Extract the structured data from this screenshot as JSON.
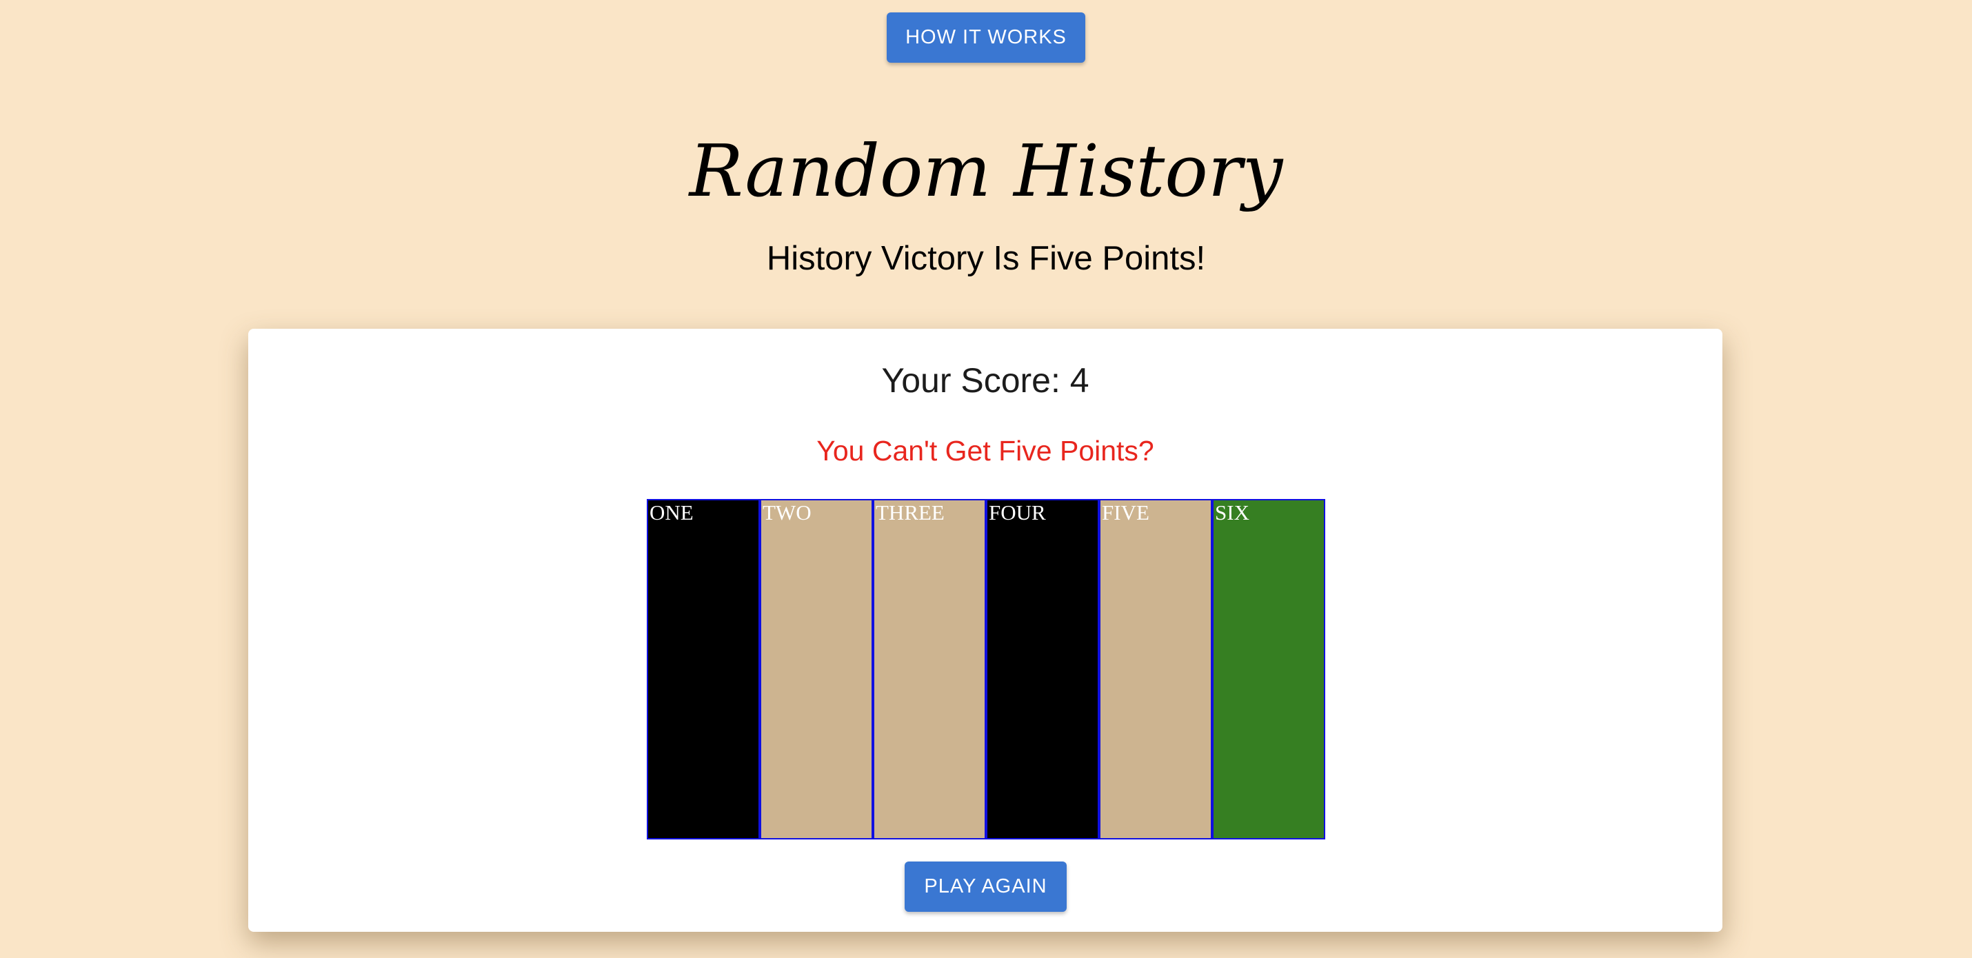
{
  "header": {
    "how_it_works_label": "HOW IT WORKS",
    "title": "Random History",
    "subtitle": "History Victory Is Five Points!"
  },
  "game": {
    "score_text": "Your Score: 4",
    "message": "You Can't Get Five Points?",
    "play_again_label": "PLAY AGAIN",
    "slots": [
      {
        "label": "ONE",
        "color": "#000000"
      },
      {
        "label": "TWO",
        "color": "#cdb490"
      },
      {
        "label": "THREE",
        "color": "#cdb490"
      },
      {
        "label": "FOUR",
        "color": "#000000"
      },
      {
        "label": "FIVE",
        "color": "#cdb490"
      },
      {
        "label": "SIX",
        "color": "#367f22"
      }
    ]
  },
  "colors": {
    "page_background": "#fae5c7",
    "button": "#3a77d2",
    "message": "#e8261e",
    "slot_border": "#1010e0"
  }
}
